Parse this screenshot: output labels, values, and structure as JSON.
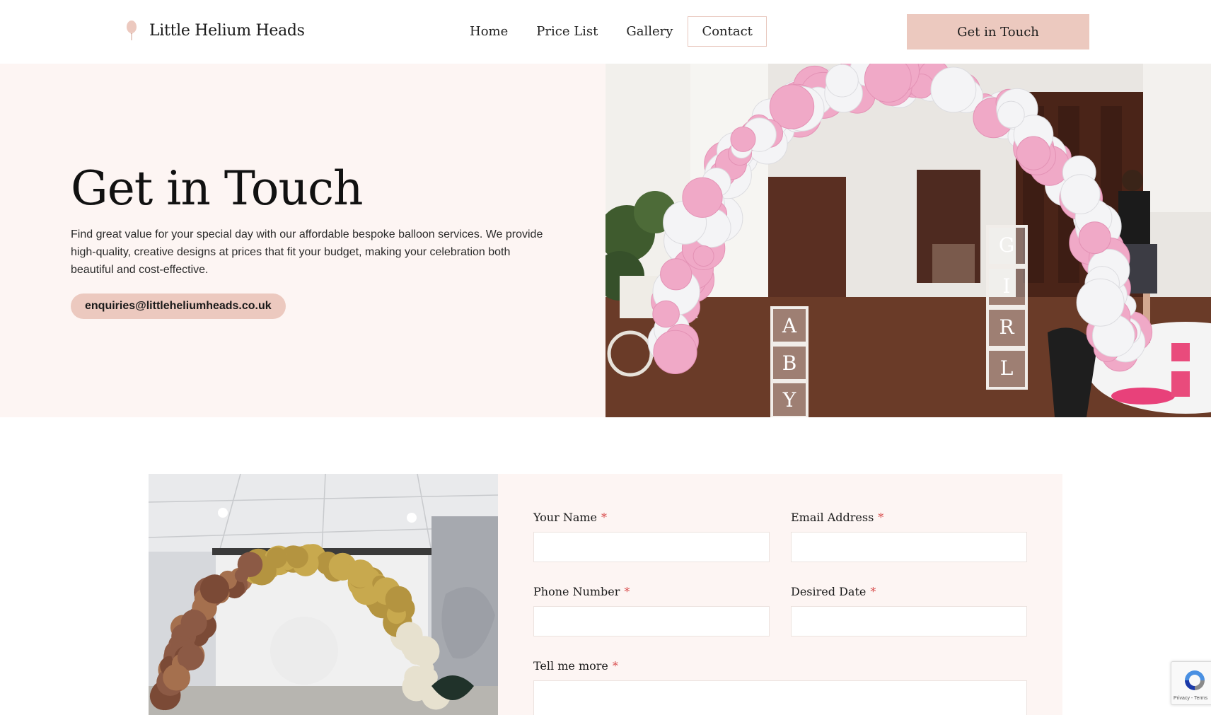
{
  "header": {
    "logo_text": "Little Helium Heads",
    "nav": [
      {
        "label": "Home",
        "active": false
      },
      {
        "label": "Price List",
        "active": false
      },
      {
        "label": "Gallery",
        "active": false
      },
      {
        "label": "Contact",
        "active": true
      }
    ],
    "cta_label": "Get in Touch"
  },
  "hero": {
    "title": "Get in Touch",
    "description": "Find great value for your special day with our affordable bespoke balloon services. We provide high-quality, creative designs at prices that fit your budget, making your celebration both beautiful and cost-effective.",
    "email": "enquiries@littleheliumheads.co.uk",
    "box_letters": [
      "A",
      "B",
      "Y",
      "G",
      "I",
      "R",
      "L"
    ]
  },
  "form": {
    "fields": [
      {
        "label": "Your Name",
        "required_mark": "*",
        "value": ""
      },
      {
        "label": "Email Address",
        "required_mark": "*",
        "value": ""
      },
      {
        "label": "Phone Number",
        "required_mark": "*",
        "value": ""
      },
      {
        "label": "Desired Date",
        "required_mark": "*",
        "value": ""
      },
      {
        "label": "Tell me more",
        "required_mark": "*",
        "value": ""
      }
    ]
  },
  "recaptcha": {
    "text": "Privacy - Terms",
    "icon": "recaptcha-icon"
  },
  "colors": {
    "accent": "#ecc9bf",
    "hero_bg": "#fdf5f3",
    "required": "#d84c4c"
  }
}
